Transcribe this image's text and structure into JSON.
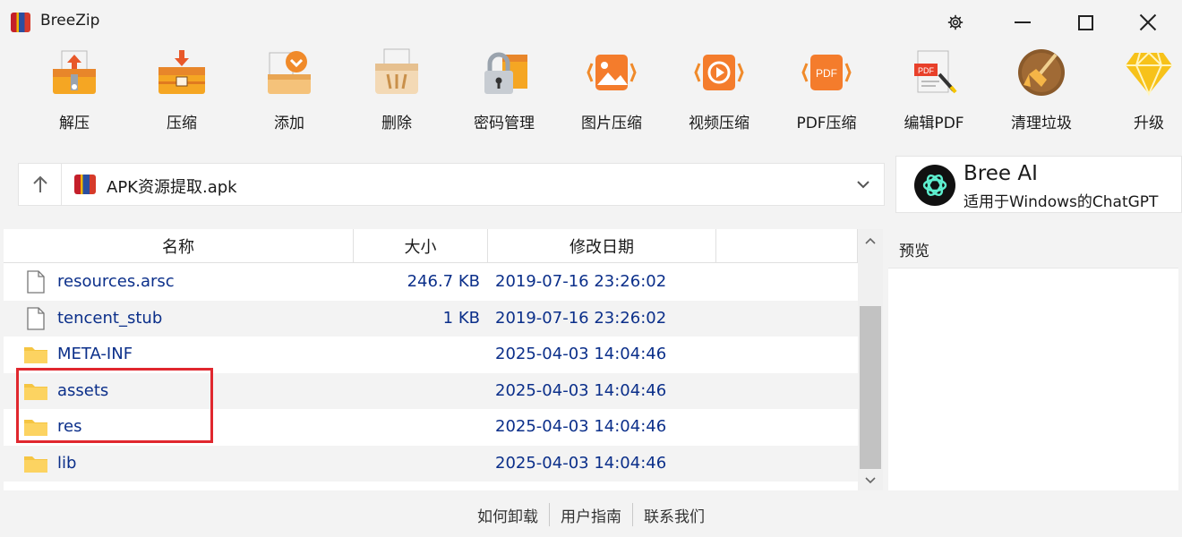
{
  "window": {
    "title": "BreeZip",
    "controls": [
      "settings",
      "minimize",
      "maximize",
      "close"
    ]
  },
  "toolbar": {
    "items": [
      {
        "label": "解压",
        "icon": "extract-icon"
      },
      {
        "label": "压缩",
        "icon": "compress-icon"
      },
      {
        "label": "添加",
        "icon": "add-icon"
      },
      {
        "label": "删除",
        "icon": "delete-icon"
      },
      {
        "label": "密码管理",
        "icon": "password-icon"
      },
      {
        "label": "图片压缩",
        "icon": "image-compress-icon"
      },
      {
        "label": "视频压缩",
        "icon": "video-compress-icon"
      },
      {
        "label": "PDF压缩",
        "icon": "pdf-compress-icon"
      },
      {
        "label": "编辑PDF",
        "icon": "edit-pdf-icon"
      },
      {
        "label": "清理垃圾",
        "icon": "clean-icon"
      },
      {
        "label": "升级",
        "icon": "upgrade-diamond-icon"
      }
    ],
    "pdf_badge": "PDF"
  },
  "path": {
    "current": "APK资源提取.apk"
  },
  "ai": {
    "title": "Bree AI",
    "subtitle": "适用于Windows的ChatGPT"
  },
  "filelist": {
    "columns": {
      "name": "名称",
      "size": "大小",
      "modified": "修改日期"
    },
    "rows": [
      {
        "name": "resources.arsc",
        "size": "246.7 KB",
        "modified": "2019-07-16 23:26:02",
        "type": "file"
      },
      {
        "name": "tencent_stub",
        "size": "1 KB",
        "modified": "2019-07-16 23:26:02",
        "type": "file"
      },
      {
        "name": "META-INF",
        "size": "",
        "modified": "2025-04-03 14:04:46",
        "type": "folder"
      },
      {
        "name": "assets",
        "size": "",
        "modified": "2025-04-03 14:04:46",
        "type": "folder"
      },
      {
        "name": "res",
        "size": "",
        "modified": "2025-04-03 14:04:46",
        "type": "folder"
      },
      {
        "name": "lib",
        "size": "",
        "modified": "2025-04-03 14:04:46",
        "type": "folder"
      }
    ]
  },
  "preview": {
    "title": "预览"
  },
  "footer": {
    "links": [
      "如何卸载",
      "用户指南",
      "联系我们"
    ]
  },
  "colors": {
    "accent_text": "#0b2f8a",
    "highlight_border": "#e0272e",
    "toolbar_orange": "#f08a2a"
  }
}
